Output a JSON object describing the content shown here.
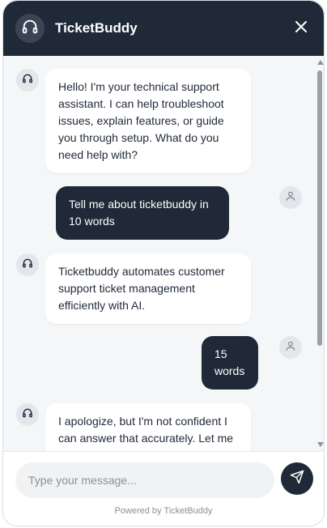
{
  "header": {
    "title": "TicketBuddy",
    "icon": "headset-icon",
    "close_icon": "close-icon"
  },
  "messages": [
    {
      "role": "bot",
      "text": "Hello! I'm your technical support assistant. I can help troubleshoot issues, explain features, or guide you through setup. What do you need help with?"
    },
    {
      "role": "user",
      "text": "Tell me about ticketbuddy in 10 words"
    },
    {
      "role": "bot",
      "text": "Ticketbuddy automates customer support ticket management efficiently with AI."
    },
    {
      "role": "user",
      "text": "15 words"
    },
    {
      "role": "bot",
      "text": "I apologize, but I'm not confident I can answer that accurately. Let me"
    }
  ],
  "composer": {
    "placeholder": "Type your message...",
    "send_icon": "send-icon"
  },
  "footer": {
    "powered_by": "Powered by TicketBuddy"
  },
  "colors": {
    "header_bg": "#1f2937",
    "user_bubble": "#1f2937",
    "bot_bubble": "#ffffff",
    "panel_bg": "#f5f6f8"
  }
}
